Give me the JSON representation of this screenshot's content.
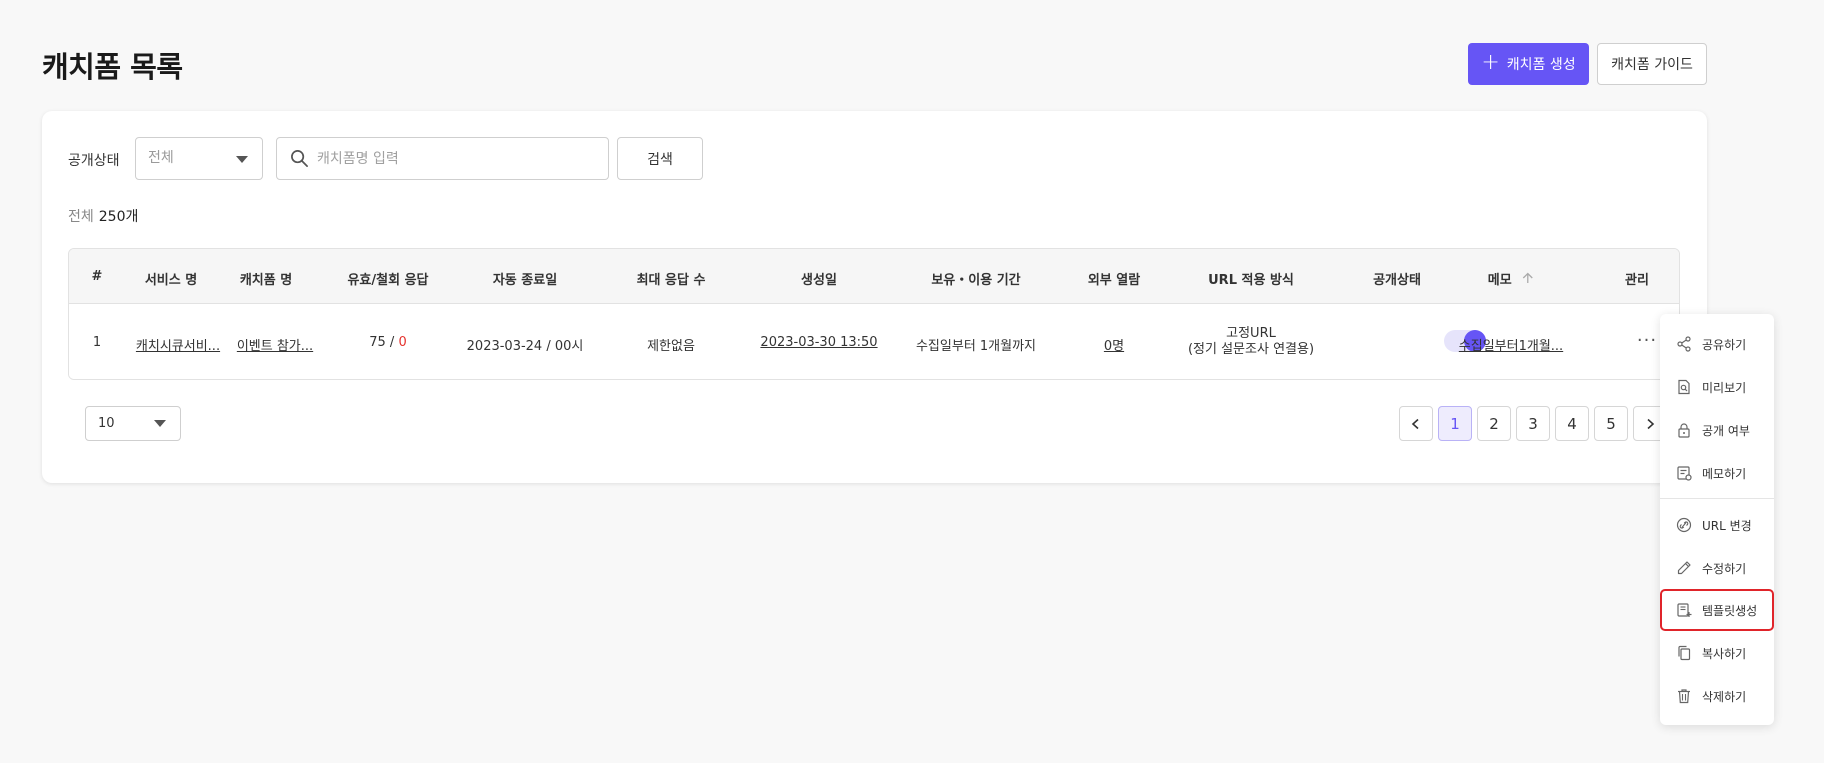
{
  "page": {
    "title": "캐치폼 목록"
  },
  "header": {
    "create_label": "캐치폼 생성",
    "guide_label": "캐치폼 가이드"
  },
  "filter": {
    "status_label": "공개상태",
    "status_value": "전체",
    "search_placeholder": "캐치폼명 입력",
    "search_value": "",
    "search_button": "검색"
  },
  "summary": {
    "total_label": "전체",
    "total_value": "250개"
  },
  "table": {
    "columns": [
      "#",
      "서비스 명",
      "캐치폼 명",
      "유효/철회 응답",
      "자동 종료일",
      "최대 응답 수",
      "생성일",
      "보유・이용 기간",
      "외부 열람",
      "URL 적용 방식",
      "공개상태",
      "메모",
      "관리"
    ],
    "sort_icon": "arrow-up-icon",
    "rows": [
      {
        "no": "1",
        "service": "캐치시큐서비...",
        "form_name": "이벤트 참가...",
        "valid": "75",
        "sep": " / ",
        "withdrawn": "0",
        "auto_end": "2023-03-24 / 00시",
        "max_responses": "제한없음",
        "created": "2023-03-30 13:50",
        "retention": "수집일부터 1개월까지",
        "external_view": "0명",
        "url_line1": "고정URL",
        "url_line2": "(정기 설문조사 연결용)",
        "public": true,
        "memo": "수집일부터1개월...",
        "more": "···"
      }
    ]
  },
  "pagination": {
    "page_size": "10",
    "pages": [
      "1",
      "2",
      "3",
      "4",
      "5"
    ],
    "current": "1"
  },
  "menu": {
    "items": [
      {
        "label": "공유하기",
        "icon": "share-icon"
      },
      {
        "label": "미리보기",
        "icon": "preview-icon"
      },
      {
        "label": "공개 여부",
        "icon": "lock-icon"
      },
      {
        "label": "메모하기",
        "icon": "memo-icon"
      },
      {
        "label": "URL 변경",
        "icon": "url-change-icon"
      },
      {
        "label": "수정하기",
        "icon": "pencil-icon"
      },
      {
        "label": "템플릿생성",
        "icon": "template-icon"
      },
      {
        "label": "복사하기",
        "icon": "copy-icon"
      },
      {
        "label": "삭제하기",
        "icon": "trash-icon"
      }
    ],
    "highlighted": "템플릿생성"
  },
  "colors": {
    "accent": "#6655f5",
    "danger": "#e5322d",
    "highlight_border": "#e0242a"
  }
}
